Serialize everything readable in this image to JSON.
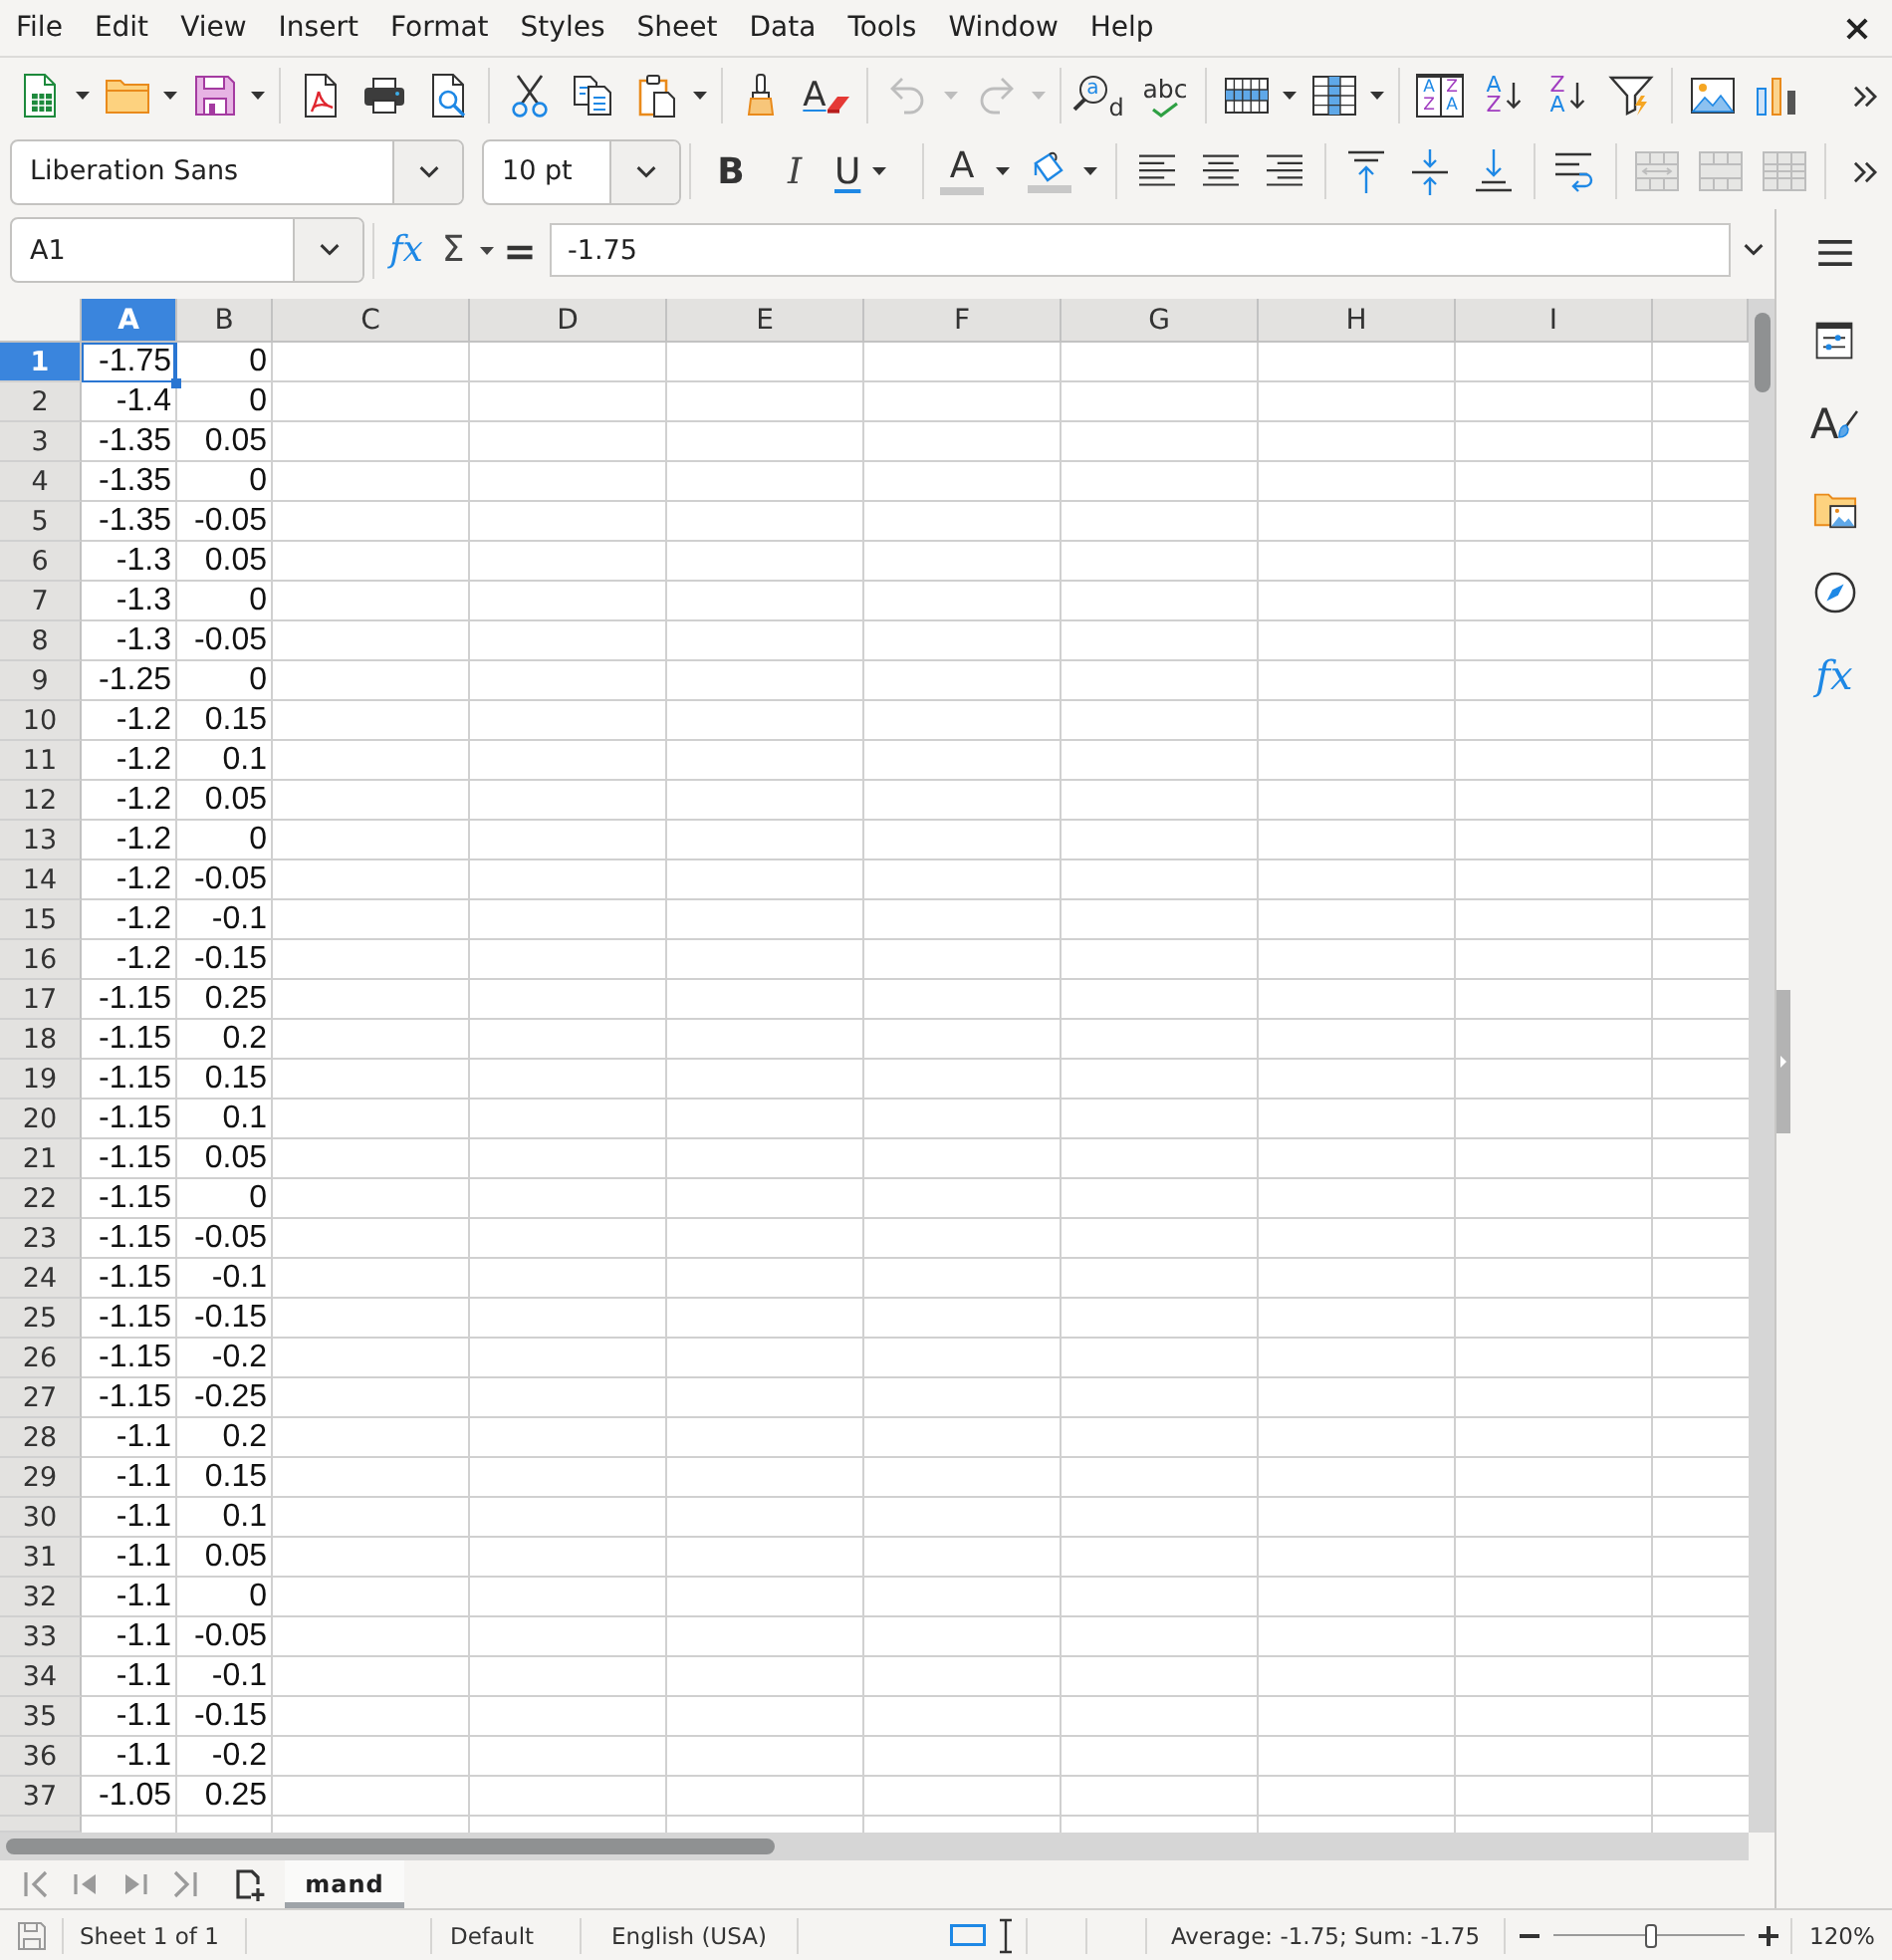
{
  "menu_bar": {
    "items": [
      "File",
      "Edit",
      "View",
      "Insert",
      "Format",
      "Styles",
      "Sheet",
      "Data",
      "Tools",
      "Window",
      "Help"
    ]
  },
  "standard_toolbar": {
    "clear_formatting_letter": "A",
    "undo": {
      "disabled": true
    },
    "redo": {
      "disabled": true
    },
    "find_replace_letters": [
      "a",
      "d"
    ],
    "spelling_label": "abc",
    "sort_dialog_letters": [
      [
        "A",
        "Z"
      ],
      [
        "Z",
        "A"
      ]
    ],
    "sort_ascending_letters": [
      "A",
      "Z"
    ],
    "sort_descending_letters": [
      "Z",
      "A"
    ]
  },
  "formatting_toolbar": {
    "font_name": "Liberation Sans",
    "font_size": "10 pt",
    "bold_label": "B",
    "italic_label": "I",
    "underline_label": "U",
    "font_color_label": "A",
    "merge_and_center": {
      "disabled": true
    },
    "merge_cells": {
      "disabled": true
    },
    "unmerge_cells": {
      "disabled": true
    }
  },
  "formula_bar": {
    "name_box": "A1",
    "function_wizard_label": "fx",
    "sum_label": "Σ",
    "equals_label": "=",
    "formula": "-1.75"
  },
  "sheet": {
    "columns": [
      {
        "label": "A",
        "selected": true
      },
      {
        "label": "B",
        "selected": false
      },
      {
        "label": "C",
        "selected": false
      },
      {
        "label": "D",
        "selected": false
      },
      {
        "label": "E",
        "selected": false
      },
      {
        "label": "F",
        "selected": false
      },
      {
        "label": "G",
        "selected": false
      },
      {
        "label": "H",
        "selected": false
      },
      {
        "label": "I",
        "selected": false
      }
    ],
    "rows": [
      {
        "number": "1",
        "selected": true,
        "cells": [
          "-1.75",
          "0"
        ]
      },
      {
        "number": "2",
        "selected": false,
        "cells": [
          "-1.4",
          "0"
        ]
      },
      {
        "number": "3",
        "selected": false,
        "cells": [
          "-1.35",
          "0.05"
        ]
      },
      {
        "number": "4",
        "selected": false,
        "cells": [
          "-1.35",
          "0"
        ]
      },
      {
        "number": "5",
        "selected": false,
        "cells": [
          "-1.35",
          "-0.05"
        ]
      },
      {
        "number": "6",
        "selected": false,
        "cells": [
          "-1.3",
          "0.05"
        ]
      },
      {
        "number": "7",
        "selected": false,
        "cells": [
          "-1.3",
          "0"
        ]
      },
      {
        "number": "8",
        "selected": false,
        "cells": [
          "-1.3",
          "-0.05"
        ]
      },
      {
        "number": "9",
        "selected": false,
        "cells": [
          "-1.25",
          "0"
        ]
      },
      {
        "number": "10",
        "selected": false,
        "cells": [
          "-1.2",
          "0.15"
        ]
      },
      {
        "number": "11",
        "selected": false,
        "cells": [
          "-1.2",
          "0.1"
        ]
      },
      {
        "number": "12",
        "selected": false,
        "cells": [
          "-1.2",
          "0.05"
        ]
      },
      {
        "number": "13",
        "selected": false,
        "cells": [
          "-1.2",
          "0"
        ]
      },
      {
        "number": "14",
        "selected": false,
        "cells": [
          "-1.2",
          "-0.05"
        ]
      },
      {
        "number": "15",
        "selected": false,
        "cells": [
          "-1.2",
          "-0.1"
        ]
      },
      {
        "number": "16",
        "selected": false,
        "cells": [
          "-1.2",
          "-0.15"
        ]
      },
      {
        "number": "17",
        "selected": false,
        "cells": [
          "-1.15",
          "0.25"
        ]
      },
      {
        "number": "18",
        "selected": false,
        "cells": [
          "-1.15",
          "0.2"
        ]
      },
      {
        "number": "19",
        "selected": false,
        "cells": [
          "-1.15",
          "0.15"
        ]
      },
      {
        "number": "20",
        "selected": false,
        "cells": [
          "-1.15",
          "0.1"
        ]
      },
      {
        "number": "21",
        "selected": false,
        "cells": [
          "-1.15",
          "0.05"
        ]
      },
      {
        "number": "22",
        "selected": false,
        "cells": [
          "-1.15",
          "0"
        ]
      },
      {
        "number": "23",
        "selected": false,
        "cells": [
          "-1.15",
          "-0.05"
        ]
      },
      {
        "number": "24",
        "selected": false,
        "cells": [
          "-1.15",
          "-0.1"
        ]
      },
      {
        "number": "25",
        "selected": false,
        "cells": [
          "-1.15",
          "-0.15"
        ]
      },
      {
        "number": "26",
        "selected": false,
        "cells": [
          "-1.15",
          "-0.2"
        ]
      },
      {
        "number": "27",
        "selected": false,
        "cells": [
          "-1.15",
          "-0.25"
        ]
      },
      {
        "number": "28",
        "selected": false,
        "cells": [
          "-1.1",
          "0.2"
        ]
      },
      {
        "number": "29",
        "selected": false,
        "cells": [
          "-1.1",
          "0.15"
        ]
      },
      {
        "number": "30",
        "selected": false,
        "cells": [
          "-1.1",
          "0.1"
        ]
      },
      {
        "number": "31",
        "selected": false,
        "cells": [
          "-1.1",
          "0.05"
        ]
      },
      {
        "number": "32",
        "selected": false,
        "cells": [
          "-1.1",
          "0"
        ]
      },
      {
        "number": "33",
        "selected": false,
        "cells": [
          "-1.1",
          "-0.05"
        ]
      },
      {
        "number": "34",
        "selected": false,
        "cells": [
          "-1.1",
          "-0.1"
        ]
      },
      {
        "number": "35",
        "selected": false,
        "cells": [
          "-1.1",
          "-0.15"
        ]
      },
      {
        "number": "36",
        "selected": false,
        "cells": [
          "-1.1",
          "-0.2"
        ]
      },
      {
        "number": "37",
        "selected": false,
        "cells": [
          "-1.05",
          "0.25"
        ]
      }
    ]
  },
  "sheet_navigation": {
    "disabled": true
  },
  "sheet_tabs": [
    {
      "label": "mand",
      "selected": true
    }
  ],
  "status_bar": {
    "sheet_position": "Sheet 1 of 1",
    "page_style": "Default",
    "language": "English (USA)",
    "selection_summary": "Average: -1.75; Sum: -1.75",
    "zoom": {
      "level": 0.52,
      "reading": "120%"
    }
  },
  "sidebar": {
    "styles_letter": "A",
    "functions_label": "fx"
  }
}
